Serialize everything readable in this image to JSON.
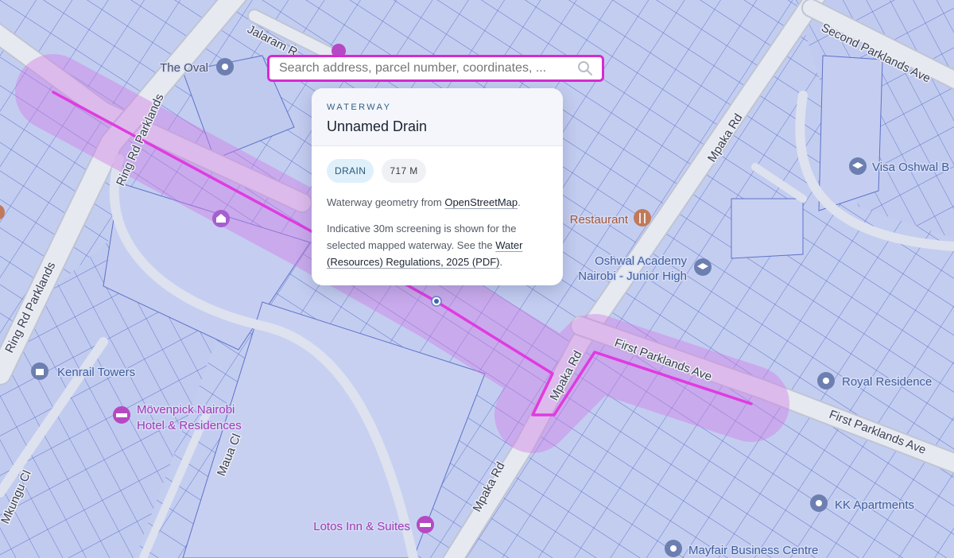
{
  "search": {
    "placeholder": "Search address, parcel number, coordinates, ..."
  },
  "icons": {
    "search": "magnifier-icon",
    "place": "place-pin-icon",
    "restaurant": "fork-knife-icon",
    "school": "graduation-cap-icon",
    "hotel": "bed-icon",
    "shop": "shopping-bag-icon",
    "worship": "temple-icon"
  },
  "colors": {
    "search_border": "#d62bd0",
    "waterway_line": "#e03be0",
    "buffer_fill": "#d27ae6",
    "parcel_fill": "#c3cdf0",
    "road": "#e6e9f0"
  },
  "roads": {
    "ring_rd_upper": "Ring Rd Parklands",
    "ring_rd_lower": "Ring Rd Parklands",
    "jalaram": "Jalaram R",
    "second_parklands": "Second Parklands Ave",
    "mpaka_upper": "Mpaka Rd",
    "mpaka_middle": "Mpaka Rd",
    "mpaka_lower": "Mpaka Rd",
    "first_parklands_a": "First Parklands Ave",
    "first_parklands_b": "First Parklands Ave",
    "maua": "Maua Cl",
    "mkungu": "Mkungu Cl"
  },
  "pois": {
    "the_oval": "The Oval",
    "visa_oshwal": "Visa Oshwal B",
    "restaurant": "Restaurant",
    "oshwal_line1": "Oshwal Academy",
    "oshwal_line2": "Nairobi - Junior High",
    "kenrail": "Kenrail Towers",
    "movenpick_line1": "Mövenpick Nairobi",
    "movenpick_line2": "Hotel & Residences",
    "royal": "Royal Residence",
    "kk": "KK Apartments",
    "lotos": "Lotos Inn & Suites",
    "mayfair": "Mayfair Business Centre"
  },
  "card": {
    "kicker": "WATERWAY",
    "title": "Unnamed Drain",
    "chip_type": "DRAIN",
    "chip_length": "717 M",
    "source_prefix": "Waterway geometry from ",
    "source_link": "OpenStreetMap",
    "source_suffix": ".",
    "screening_text": "Indicative 30m screening is shown for the selected mapped waterway. See the ",
    "regulation_link": "Water (Resources) Regulations, 2025 (PDF)",
    "screening_suffix": "."
  }
}
